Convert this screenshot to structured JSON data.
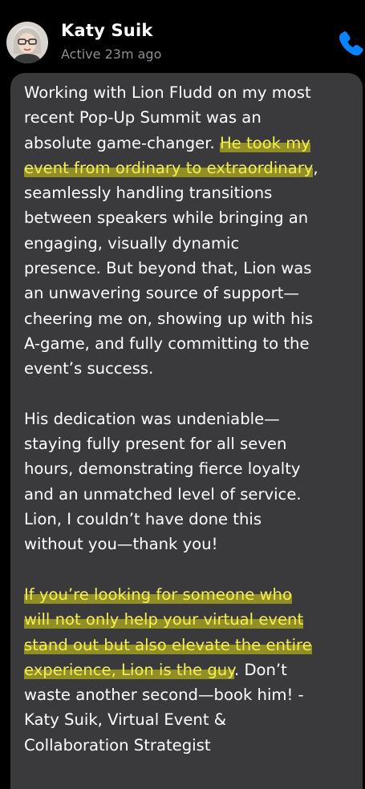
{
  "header": {
    "contact_name": "Katy Suik",
    "status": "Active 23m ago",
    "avatar_icon": "profile-photo",
    "call_icon": "phone-icon",
    "accent_color": "#0a84ff"
  },
  "message": {
    "bubble_color": "#3a3a3c",
    "highlight_color": "#e2e628",
    "paragraphs": [
      {
        "lines": [
          "Working with Lion Fludd on my most",
          "recent Pop-Up Summit was an",
          "absolute game-changer. ",
          "He took my",
          "event from ordinary to extraordinary",
          ",",
          "seamlessly handling transitions",
          "between speakers while bringing an",
          "engaging, visually dynamic",
          "presence. But beyond that, Lion was",
          "an unwavering source of support—",
          "cheering me on, showing up with his",
          "A-game, and fully committing to the",
          "event’s success."
        ]
      },
      {
        "lines": [
          "His dedication was undeniable—",
          "staying fully present for all seven",
          "hours, demonstrating fierce loyalty",
          "and an unmatched level of service.",
          "Lion, I couldn’t have done this",
          "without you—thank you!"
        ]
      },
      {
        "lines": [
          "If you’re looking for someone who",
          "will not only help your virtual event",
          "stand out but also elevate the entire",
          "experience, Lion is the guy",
          ". Don’t",
          "waste another second—book him! -",
          "Katy Suik, Virtual Event &",
          "Collaboration Strategist"
        ]
      }
    ]
  }
}
